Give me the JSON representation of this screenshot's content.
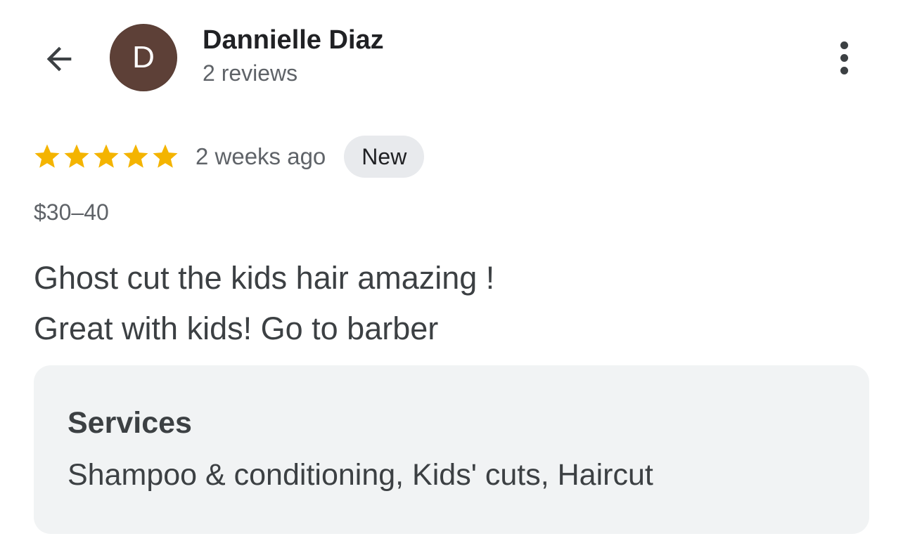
{
  "header": {
    "back_icon": "arrow-back-icon",
    "avatar_initial": "D",
    "avatar_color": "#5d4037",
    "reviewer_name": "Dannielle Diaz",
    "reviewer_review_count": "2 reviews",
    "more_icon": "more-vert-icon"
  },
  "review": {
    "rating": 5,
    "rating_max": 5,
    "star_color": "#f4b400",
    "time_ago": "2 weeks ago",
    "badge": "New",
    "price_range": "$30–40",
    "text_lines": [
      "Ghost cut the kids hair amazing !",
      "Great with kids! Go to barber"
    ]
  },
  "services": {
    "title": "Services",
    "list": "Shampoo & conditioning, Kids' cuts, Haircut"
  }
}
